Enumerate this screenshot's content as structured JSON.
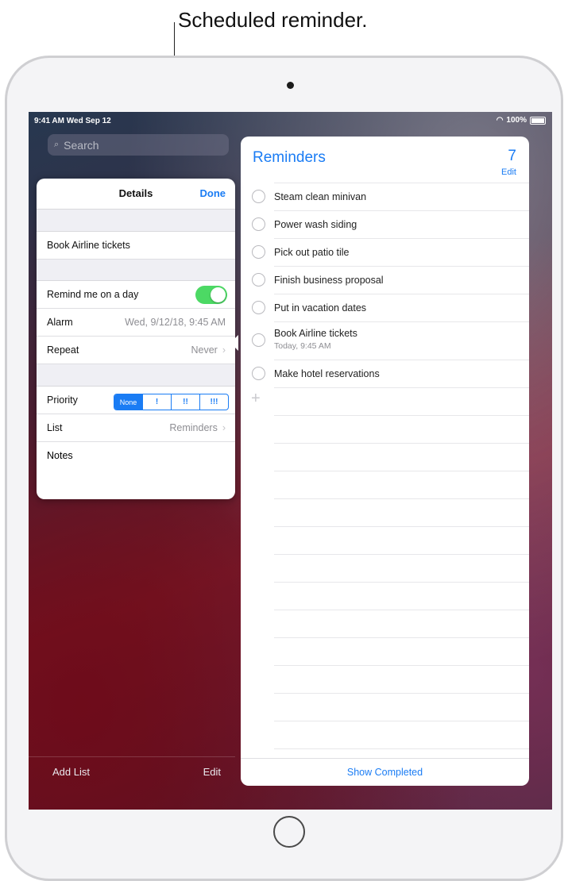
{
  "callout": {
    "text": "Scheduled reminder."
  },
  "status_bar": {
    "time": "9:41 AM  Wed Sep 12",
    "battery": "100%"
  },
  "sidebar": {
    "search_placeholder": "Search",
    "add_list": "Add List",
    "edit": "Edit"
  },
  "details": {
    "title": "Details",
    "done": "Done",
    "reminder_title": "Book Airline tickets",
    "remind_label": "Remind me on a day",
    "remind_on": true,
    "alarm_label": "Alarm",
    "alarm_value": "Wed, 9/12/18, 9:45 AM",
    "repeat_label": "Repeat",
    "repeat_value": "Never",
    "priority_label": "Priority",
    "priority_options": [
      "None",
      "!",
      "!!",
      "!!!"
    ],
    "priority_selected": "None",
    "list_label": "List",
    "list_value": "Reminders",
    "notes_label": "Notes"
  },
  "reminders": {
    "title": "Reminders",
    "count": "7",
    "edit": "Edit",
    "items": [
      {
        "text": "Steam clean minivan"
      },
      {
        "text": "Power wash siding"
      },
      {
        "text": "Pick out patio tile"
      },
      {
        "text": "Finish business proposal"
      },
      {
        "text": "Put in vacation dates"
      },
      {
        "text": "Book Airline tickets",
        "subtitle": "Today, 9:45 AM"
      },
      {
        "text": "Make hotel reservations"
      }
    ],
    "show_completed": "Show Completed"
  },
  "colors": {
    "accent": "#1a7cf4",
    "toggle_on": "#4cd964"
  },
  "icons": [
    "search-icon",
    "wifi-icon",
    "battery-icon",
    "chevron-right-icon",
    "plus-icon"
  ]
}
